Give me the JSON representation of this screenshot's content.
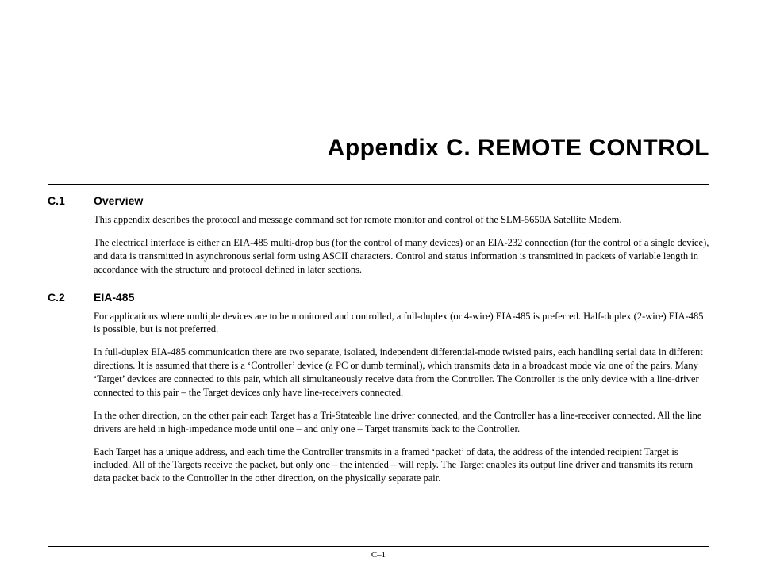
{
  "title": "Appendix C.  REMOTE CONTROL",
  "sections": [
    {
      "num": "C.1",
      "heading": "Overview",
      "paragraphs": [
        "This appendix describes the protocol and message command set for remote monitor and control of the SLM-5650A Satellite Modem.",
        "The electrical interface is either an EIA-485 multi-drop bus (for the control of many devices) or an EIA-232 connection (for the control of a single device), and data is transmitted in asynchronous serial form using ASCII characters. Control and status information is transmitted in packets of variable length in accordance with the structure and protocol defined in later sections."
      ]
    },
    {
      "num": "C.2",
      "heading": "EIA-485",
      "paragraphs": [
        "For applications where multiple devices are to be monitored and controlled, a full-duplex (or 4-wire) EIA-485 is preferred. Half-duplex (2-wire) EIA-485 is possible, but is not preferred.",
        "In full-duplex EIA-485 communication there are two separate, isolated, independent differential-mode twisted pairs, each handling serial data in different directions. It is assumed that there is a ‘Controller’ device (a PC or dumb terminal), which transmits data in a broadcast mode via one of the pairs. Many ‘Target’ devices are connected to this pair, which all simultaneously receive data from the Controller. The Controller is the only device with a line-driver connected to this pair – the Target devices only have line-receivers connected.",
        "In the other direction, on the other pair each Target has a Tri-Stateable line driver connected, and the Controller has a line-receiver connected. All the line drivers are held in high-impedance mode until one – and only one – Target transmits back to the Controller.",
        "Each Target has a unique address, and each time the Controller transmits in a framed ‘packet’ of data, the address of the intended recipient Target is included. All of the Targets receive the packet, but only one – the intended – will reply. The Target enables its output line driver and transmits its return data packet back to the Controller in the other direction, on the physically separate pair."
      ]
    }
  ],
  "page_number": "C–1"
}
